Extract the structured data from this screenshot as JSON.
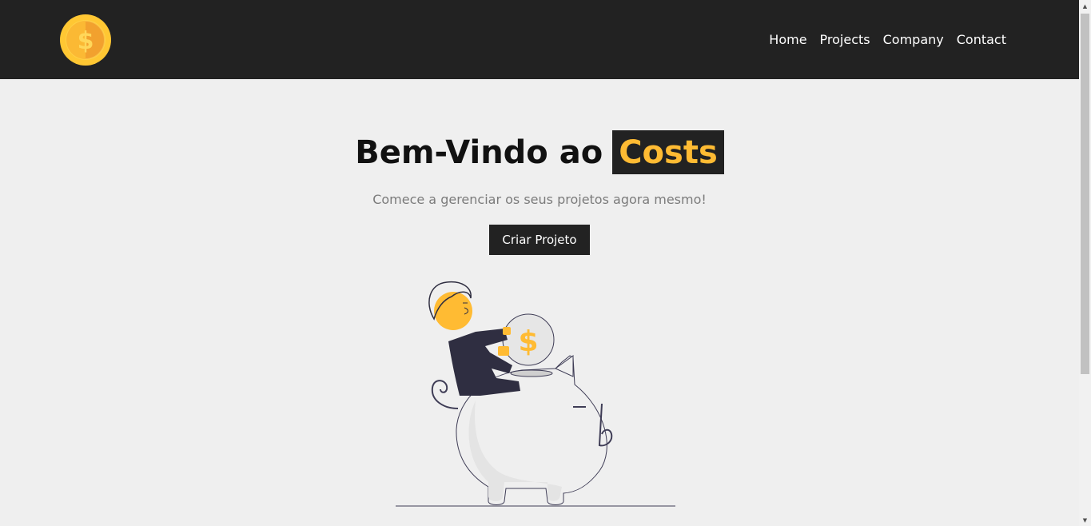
{
  "nav": {
    "logo_icon": "coin-dollar-icon",
    "items": [
      {
        "label": "Home"
      },
      {
        "label": "Projects"
      },
      {
        "label": "Company"
      },
      {
        "label": "Contact"
      }
    ]
  },
  "hero": {
    "title_prefix": "Bem-Vindo ao",
    "title_brand": "Costs",
    "subtitle": "Comece a gerenciar os seus projetos agora mesmo!",
    "cta_label": "Criar Projeto",
    "illustration": "piggy-bank-savings-illustration"
  },
  "colors": {
    "navbar_bg": "#222222",
    "page_bg": "#efefef",
    "accent": "#ffbb33",
    "text_dark": "#111111",
    "text_muted": "#7b7b7b"
  }
}
